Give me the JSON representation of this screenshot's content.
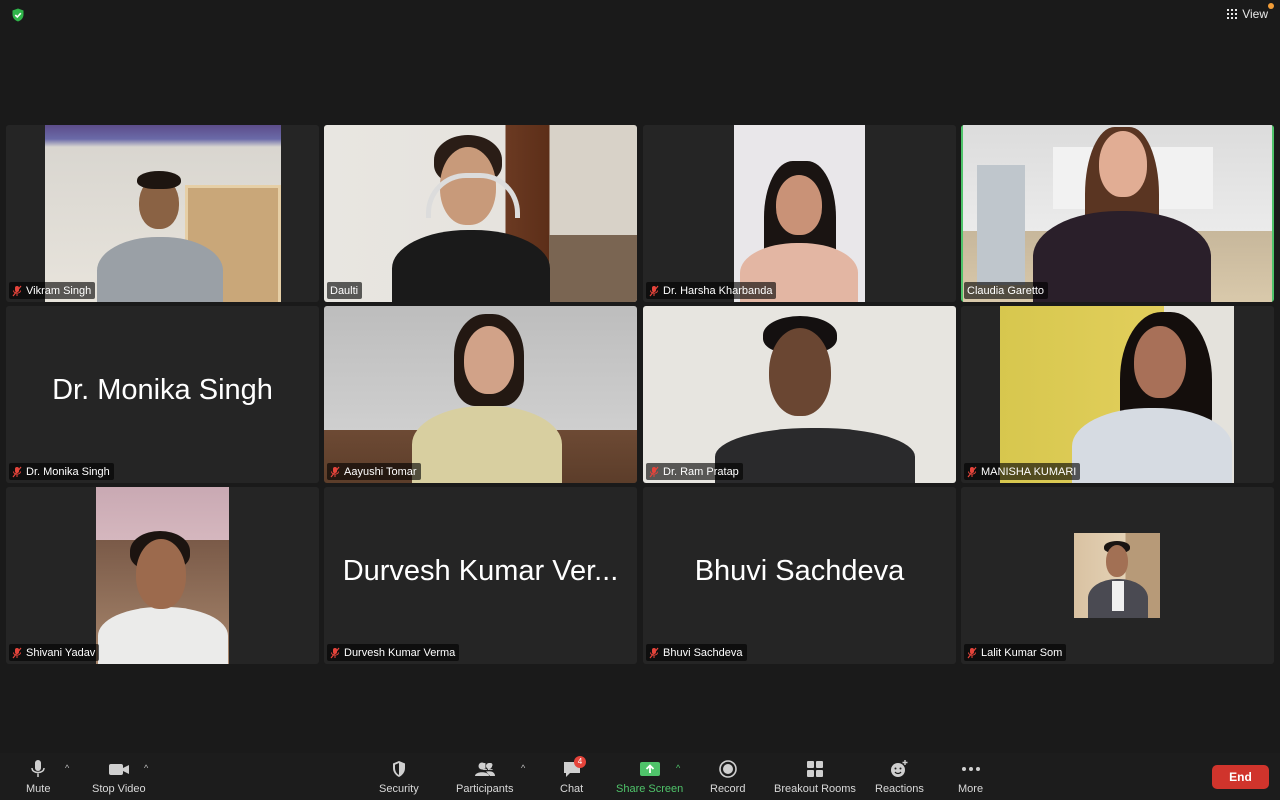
{
  "header": {
    "view_label": "View",
    "encryption_icon": "green-shield-check-icon"
  },
  "participants": [
    {
      "name": "Vikram Singh",
      "muted": true,
      "video": true,
      "active_speaker": false
    },
    {
      "name": "Daulti",
      "muted": false,
      "video": true,
      "active_speaker": false
    },
    {
      "name": "Dr. Harsha Kharbanda",
      "muted": true,
      "video": true,
      "active_speaker": false
    },
    {
      "name": "Claudia Garetto",
      "muted": false,
      "video": true,
      "active_speaker": true
    },
    {
      "name": "Dr. Monika Singh",
      "muted": true,
      "video": false,
      "display_name": "Dr. Monika Singh"
    },
    {
      "name": "Aayushi Tomar",
      "muted": true,
      "video": true,
      "active_speaker": false
    },
    {
      "name": "Dr. Ram Pratap",
      "muted": true,
      "video": true,
      "active_speaker": false
    },
    {
      "name": "MANISHA KUMARI",
      "muted": true,
      "video": true,
      "active_speaker": false
    },
    {
      "name": "Shivani Yadav",
      "muted": true,
      "video": true,
      "active_speaker": false
    },
    {
      "name": "Durvesh Kumar Verma",
      "muted": true,
      "video": false,
      "display_name": "Durvesh Kumar Ver..."
    },
    {
      "name": "Bhuvi Sachdeva",
      "muted": true,
      "video": false,
      "display_name": "Bhuvi Sachdeva"
    },
    {
      "name": "Lalit Kumar Som",
      "muted": true,
      "video": true,
      "active_speaker": false
    }
  ],
  "toolbar": {
    "mute": "Mute",
    "stop_video": "Stop Video",
    "security": "Security",
    "participants": "Participants",
    "participants_count": "12",
    "chat": "Chat",
    "chat_badge": "4",
    "share_screen": "Share Screen",
    "record": "Record",
    "breakout_rooms": "Breakout Rooms",
    "reactions": "Reactions",
    "more": "More",
    "end": "End"
  },
  "colors": {
    "active_speaker_border": "#4fc36a",
    "share_screen": "#4fc36a",
    "end_button": "#d0342c",
    "muted_mic": "#e5443b"
  }
}
